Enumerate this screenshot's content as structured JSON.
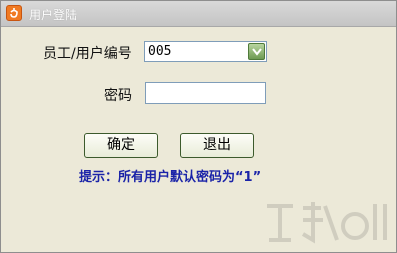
{
  "window": {
    "title": "用户登陆",
    "icon": "app-logo-icon"
  },
  "form": {
    "user_label": "员工/用户编号",
    "user_value": "005",
    "password_label": "密码",
    "password_value": ""
  },
  "buttons": {
    "confirm": "确定",
    "exit": "退出"
  },
  "hint": "提示：所有用户默认密码为“1”",
  "colors": {
    "hint": "#1a23a8",
    "titlebar": "#c4c4c4",
    "background": "#ece9d8"
  }
}
